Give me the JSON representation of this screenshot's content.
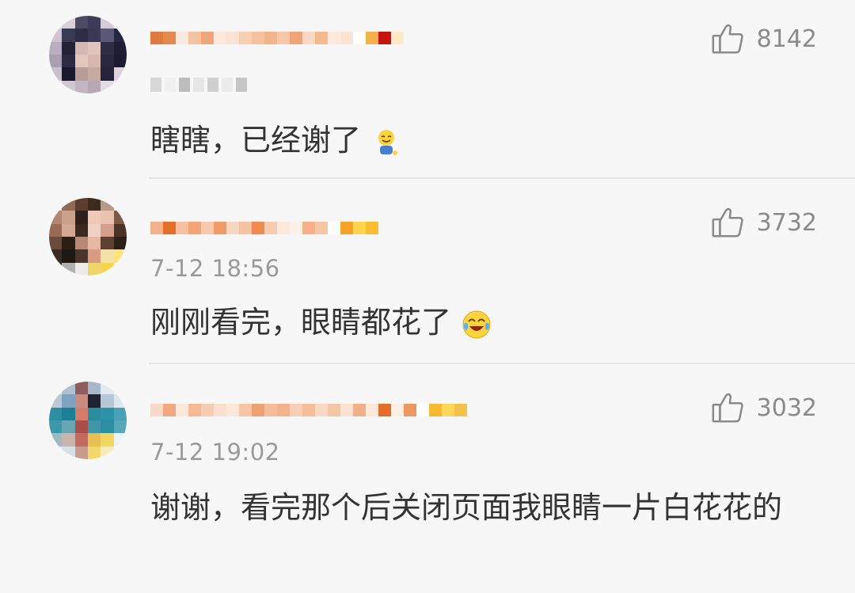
{
  "comments": [
    {
      "time": "",
      "text": "瞎瞎，已经谢了",
      "likes": "8142",
      "emoji": "smiling-face-emoji"
    },
    {
      "time": "7-12 18:56",
      "text": "刚刚看完，眼睛都花了",
      "likes": "3732",
      "emoji": "crying-laughing-emoji"
    },
    {
      "time": "7-12 19:02",
      "text": "谢谢，看完那个后关闭页面我眼睛一片白花花的",
      "likes": "3032",
      "emoji": ""
    }
  ],
  "icons": {
    "like": "thumbs-up-icon"
  },
  "colors": {
    "background": "#f7f7f7",
    "text": "#333333",
    "meta": "#9a9a9a",
    "divider": "#e6e6e6"
  }
}
